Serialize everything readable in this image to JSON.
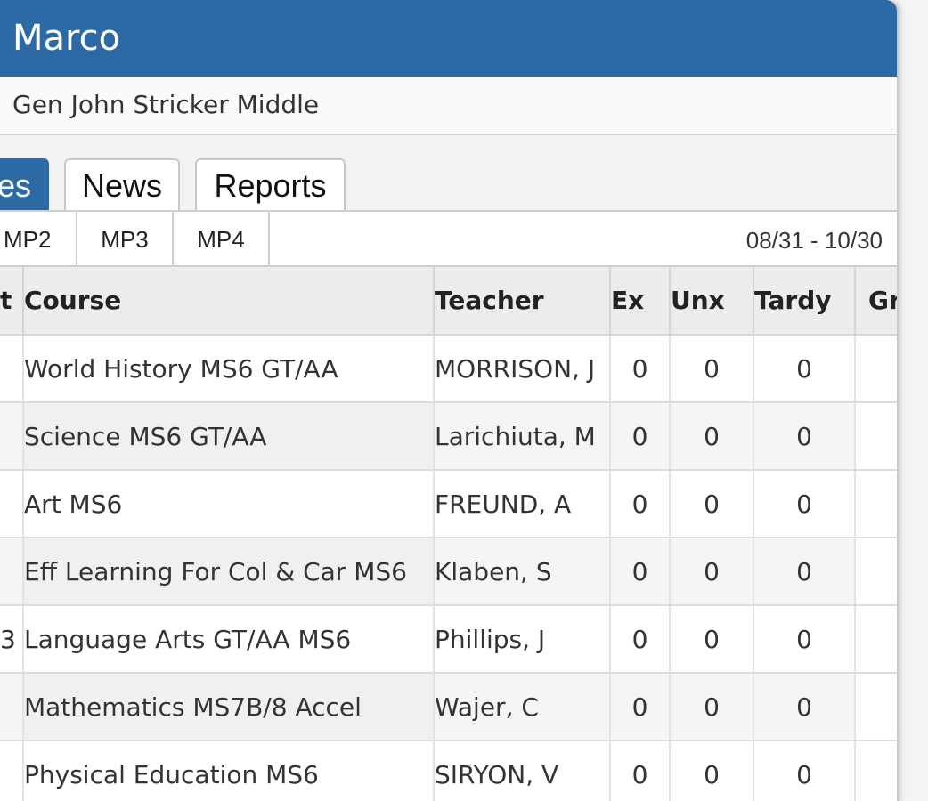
{
  "header": {
    "student_name": "Marco",
    "school": "Gen John Stricker Middle",
    "accent_color": "#2d6aa5"
  },
  "tabs": [
    {
      "label": "es",
      "active": true
    },
    {
      "label": "News",
      "active": false
    },
    {
      "label": "Reports",
      "active": false
    }
  ],
  "marking_periods": [
    "MP2",
    "MP3",
    "MP4"
  ],
  "date_range": "08/31 - 10/30",
  "table": {
    "columns": [
      "t",
      "Course",
      "Teacher",
      "Ex",
      "Unx",
      "Tardy",
      "Gr"
    ],
    "rows": [
      {
        "per": "",
        "course": "World History MS6 GT/AA",
        "teacher": "MORRISON, J",
        "ex": "0",
        "unx": "0",
        "tardy": "0"
      },
      {
        "per": "",
        "course": "Science MS6 GT/AA",
        "teacher": "Larichiuta, M",
        "ex": "0",
        "unx": "0",
        "tardy": "0"
      },
      {
        "per": "",
        "course": "Art MS6",
        "teacher": "FREUND, A",
        "ex": "0",
        "unx": "0",
        "tardy": "0"
      },
      {
        "per": "",
        "course": "Eff Learning For Col & Car MS6",
        "teacher": "Klaben, S",
        "ex": "0",
        "unx": "0",
        "tardy": "0"
      },
      {
        "per": "3",
        "course": "Language Arts GT/AA MS6",
        "teacher": "Phillips, J",
        "ex": "0",
        "unx": "0",
        "tardy": "0"
      },
      {
        "per": "",
        "course": "Mathematics MS7B/8 Accel",
        "teacher": "Wajer, C",
        "ex": "0",
        "unx": "0",
        "tardy": "0"
      },
      {
        "per": "",
        "course": "Physical Education MS6",
        "teacher": "SIRYON, V",
        "ex": "0",
        "unx": "0",
        "tardy": "0"
      }
    ]
  }
}
